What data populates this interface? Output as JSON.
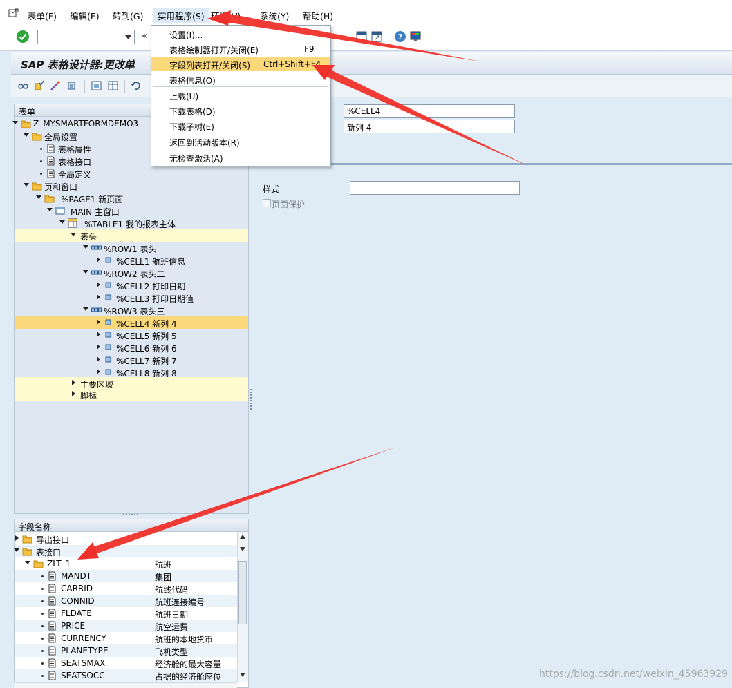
{
  "menubar": {
    "items": [
      {
        "label": "表单(F)"
      },
      {
        "label": "编辑(E)"
      },
      {
        "label": "转到(G)"
      },
      {
        "label": "实用程序(S)"
      },
      {
        "label": "环境(V)"
      },
      {
        "label": "系统(Y)"
      },
      {
        "label": "帮助(H)"
      }
    ]
  },
  "toolbar": {
    "command_field": {
      "value": "",
      "placeholder": ""
    },
    "collapse_label": "«"
  },
  "title": "SAP 表格设计器:更改单",
  "dropdown": {
    "items": [
      {
        "label": "设置(I)...",
        "shortcut": ""
      },
      {
        "label": "表格绘制器打开/关闭(E)",
        "shortcut": "F9"
      },
      {
        "label": "字段列表打开/关闭(S)",
        "shortcut": "Ctrl+Shift+F4"
      },
      {
        "label": "表格信息(O)",
        "shortcut": ""
      },
      {
        "label": "上载(U)",
        "shortcut": ""
      },
      {
        "label": "下载表格(D)",
        "shortcut": ""
      },
      {
        "label": "下载子树(E)",
        "shortcut": ""
      },
      {
        "label": "返回到活动版本(R)",
        "shortcut": ""
      },
      {
        "label": "无检查激活(A)",
        "shortcut": ""
      }
    ]
  },
  "tree": {
    "header": "表单",
    "nodes": [
      {
        "label": "Z_MYSMARTFORMDEMO3"
      },
      {
        "label": "全局设置"
      },
      {
        "label": "表格属性"
      },
      {
        "label": "表格接口"
      },
      {
        "label": "全局定义"
      },
      {
        "label": "页和窗口"
      },
      {
        "label": "%PAGE1 新页面"
      },
      {
        "label": "MAIN 主窗口"
      },
      {
        "label": "%TABLE1 我的报表主体"
      },
      {
        "label": "表头"
      },
      {
        "label": "%ROW1 表头一"
      },
      {
        "label": "%CELL1 航班信息"
      },
      {
        "label": "%ROW2 表头二"
      },
      {
        "label": "%CELL2 打印日期"
      },
      {
        "label": "%CELL3 打印日期值"
      },
      {
        "label": "%ROW3 表头三"
      },
      {
        "label": "%CELL4 新列 4"
      },
      {
        "label": "%CELL5 新列 5"
      },
      {
        "label": "%CELL6 新列 6"
      },
      {
        "label": "%CELL7 新列 7"
      },
      {
        "label": "%CELL8 新列 8"
      },
      {
        "label": "主要区域"
      },
      {
        "label": "脚标"
      }
    ]
  },
  "fields": {
    "header_name": "字段名称",
    "header_desc": "",
    "rows": [
      {
        "name": "导出接口",
        "desc": ""
      },
      {
        "name": "表接口",
        "desc": ""
      },
      {
        "name": "ZLT_1",
        "desc": "航班"
      },
      {
        "name": "MANDT",
        "desc": "集团"
      },
      {
        "name": "CARRID",
        "desc": "航线代码"
      },
      {
        "name": "CONNID",
        "desc": "航班连接编号"
      },
      {
        "name": "FLDATE",
        "desc": "航班日期"
      },
      {
        "name": "PRICE",
        "desc": "航空运费"
      },
      {
        "name": "CURRENCY",
        "desc": "航班的本地货币"
      },
      {
        "name": "PLANETYPE",
        "desc": "飞机类型"
      },
      {
        "name": "SEATSMAX",
        "desc": "经济舱的最大容量"
      },
      {
        "name": "SEATSOCC",
        "desc": "占据的经济舱座位"
      }
    ]
  },
  "detail": {
    "node_name_value": "%CELL4",
    "description_value": "新列 4",
    "style_label": "样式",
    "style_value": "",
    "page_protect_label": "页面保护"
  },
  "watermark": "https://blog.csdn.net/weixin_45963929",
  "colors": {
    "highlight": "#fbd97b",
    "tree_highlight": "#fffad0",
    "arrow": "#f0302a"
  }
}
